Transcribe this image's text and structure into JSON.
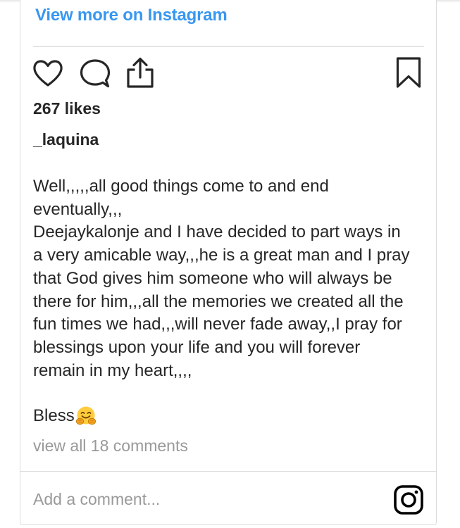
{
  "embed": {
    "view_more_label": "View more on Instagram"
  },
  "actions": {
    "like_icon": "heart-icon",
    "comment_icon": "comment-icon",
    "share_icon": "share-icon",
    "save_icon": "bookmark-icon"
  },
  "post": {
    "likes": "267 likes",
    "username": "_laquina",
    "caption_lines": [
      "Well,,,,,all good things come to and end",
      "eventually,,,",
      "Deejaykalonje and I have decided to part ways in",
      "a very amicable way,,,he is a great man and I pray",
      "that God gives him someone who will always be",
      "there for him,,,all the memories we created all the",
      "fun times we had,,,will never fade away,,I pray for",
      "blessings upon your life and you will forever",
      "remain in my heart,,,,"
    ],
    "closing_text": "Bless",
    "closing_emoji": "hugging-face-emoji",
    "view_comments_label": "view all 18 comments"
  },
  "comment_box": {
    "placeholder": "Add a comment...",
    "logo_icon": "instagram-logo-icon"
  },
  "colors": {
    "link_blue": "#3897f0",
    "text_dark": "#262626",
    "text_muted": "#999999",
    "border": "#dbdbdb"
  }
}
